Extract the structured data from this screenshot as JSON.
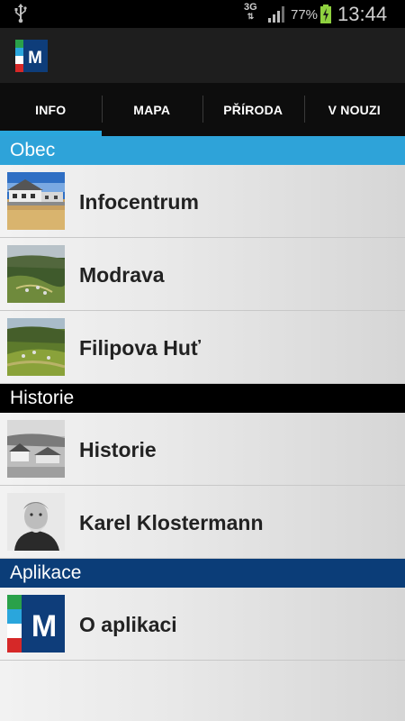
{
  "status_bar": {
    "network": "3G",
    "battery_percent": "77%",
    "time": "13:44",
    "icons": [
      "usb-icon",
      "signal-icon",
      "battery-charging-icon"
    ]
  },
  "app": {
    "logo_letter": "M"
  },
  "tabs": [
    {
      "label": "INFO",
      "active": true
    },
    {
      "label": "MAPA",
      "active": false
    },
    {
      "label": "PŘÍRODA",
      "active": false
    },
    {
      "label": "V NOUZI",
      "active": false
    }
  ],
  "sections": {
    "obec": {
      "title": "Obec",
      "color": "#2ea3d9",
      "items": [
        {
          "label": "Infocentrum",
          "thumb": "infocentrum-photo"
        },
        {
          "label": "Modrava",
          "thumb": "modrava-photo"
        },
        {
          "label": "Filipova Huť",
          "thumb": "filipova-hut-photo"
        }
      ]
    },
    "historie": {
      "title": "Historie",
      "color": "#000000",
      "items": [
        {
          "label": "Historie",
          "thumb": "historie-photo"
        },
        {
          "label": "Karel Klostermann",
          "thumb": "klostermann-portrait"
        }
      ]
    },
    "aplikace": {
      "title": "Aplikace",
      "color": "#0b3d78",
      "items": [
        {
          "label": "O aplikaci",
          "thumb": "app-logo"
        }
      ]
    }
  }
}
